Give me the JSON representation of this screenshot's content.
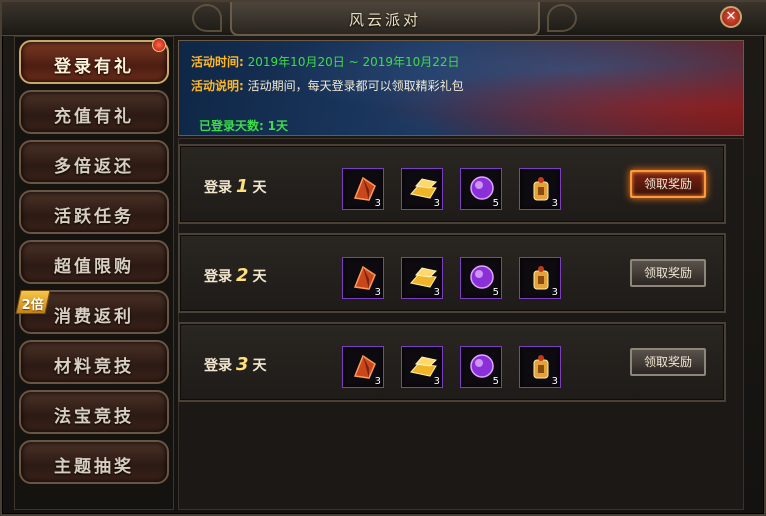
{
  "window": {
    "title": "风云派对"
  },
  "sidebar": {
    "items": [
      {
        "label": "登录有礼",
        "active": true
      },
      {
        "label": "充值有礼"
      },
      {
        "label": "多倍返还"
      },
      {
        "label": "活跃任务"
      },
      {
        "label": "超值限购"
      },
      {
        "label": "消费返利",
        "badge": "2倍"
      },
      {
        "label": "材料竞技"
      },
      {
        "label": "法宝竞技"
      },
      {
        "label": "主题抽奖"
      }
    ]
  },
  "banner": {
    "time_label": "活动时间:",
    "start_date": "2019年10月20日",
    "separator": "~",
    "end_date": "2019年10月22日",
    "desc_label": "活动说明:",
    "desc_text": "活动期间，每天登录都可以领取精彩礼包",
    "days_label": "已登录天数:",
    "days_value": "1天"
  },
  "rewards": {
    "day_prefix": "登录",
    "day_suffix": "天",
    "rows": [
      {
        "day": "1",
        "button": "领取奖励",
        "claimable": true,
        "items": [
          {
            "icon": "crystal-shard-icon",
            "count": "3"
          },
          {
            "icon": "gold-bar-icon",
            "count": "3"
          },
          {
            "icon": "purple-orb-icon",
            "count": "5"
          },
          {
            "icon": "golden-charm-icon",
            "count": "3"
          }
        ]
      },
      {
        "day": "2",
        "button": "领取奖励",
        "claimable": false,
        "items": [
          {
            "icon": "crystal-shard-icon",
            "count": "3"
          },
          {
            "icon": "gold-bar-icon",
            "count": "3"
          },
          {
            "icon": "purple-orb-icon",
            "count": "5"
          },
          {
            "icon": "golden-charm-icon",
            "count": "3"
          }
        ]
      },
      {
        "day": "3",
        "button": "领取奖励",
        "claimable": false,
        "items": [
          {
            "icon": "crystal-shard-icon",
            "count": "3"
          },
          {
            "icon": "gold-bar-icon",
            "count": "3"
          },
          {
            "icon": "purple-orb-icon",
            "count": "5"
          },
          {
            "icon": "golden-charm-icon",
            "count": "3"
          }
        ]
      }
    ]
  },
  "colors": {
    "accent_gold": "#ffb726",
    "highlight_green": "#3fdc4a",
    "active_button_glow": "#ff7a1a"
  }
}
